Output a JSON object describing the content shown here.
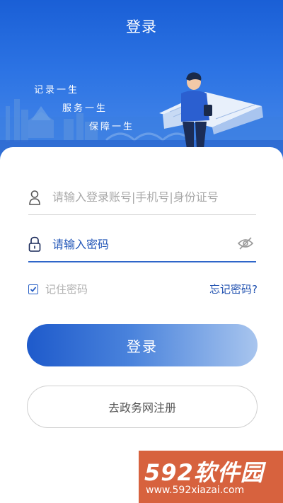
{
  "header": {
    "title": "登录",
    "slogans": [
      "记录一生",
      "服务一生",
      "保障一生"
    ]
  },
  "form": {
    "account_placeholder": "请输入登录账号|手机号|身份证号",
    "password_placeholder": "请输入密码",
    "remember_label": "记住密码",
    "remember_checked": true,
    "forgot_label": "忘记密码?"
  },
  "buttons": {
    "login_label": "登录",
    "register_label": "去政务网注册"
  },
  "watermark": {
    "logo": "592软件园",
    "url": "www.592xiazai.com"
  },
  "colors": {
    "primary": "#1e5acb",
    "header_bg": "#2d74e4",
    "link": "#1e4faf"
  },
  "icons": {
    "account": "user-icon",
    "password": "lock-icon",
    "visibility": "eye-off-icon",
    "remember": "check-icon"
  }
}
